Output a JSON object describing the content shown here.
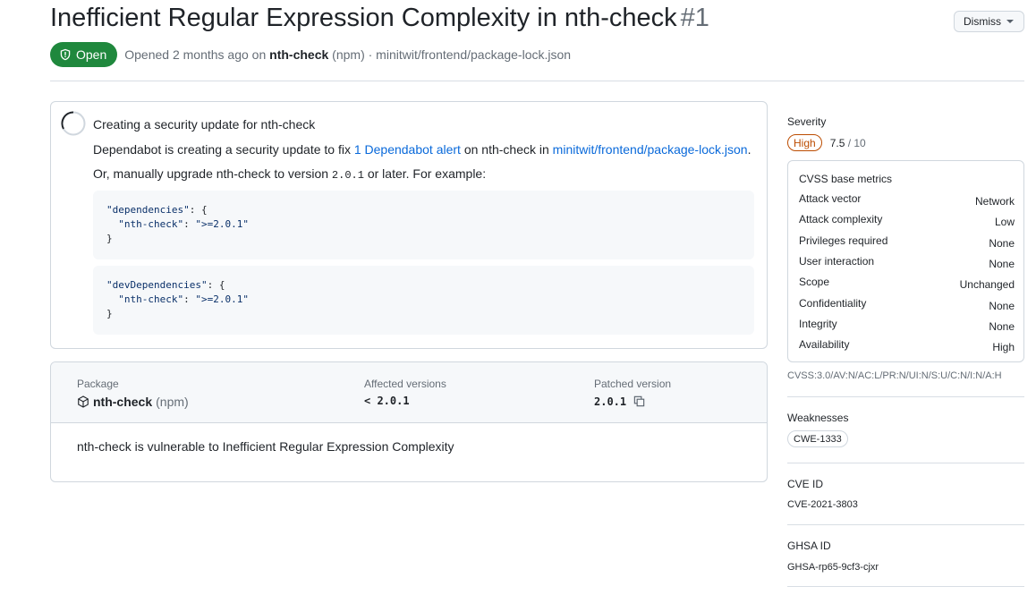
{
  "header": {
    "title": "Inefficient Regular Expression Complexity in nth-check",
    "number": "#1",
    "dismiss_label": "Dismiss"
  },
  "status": {
    "badge": "Open",
    "opened_prefix": "Opened 2 months ago on",
    "package": "nth-check",
    "ecosystem_path": "(npm) · minitwit/frontend/package-lock.json"
  },
  "update": {
    "title": "Creating a security update for nth-check",
    "line1_prefix": "Dependabot is creating a security update to fix",
    "alert_link": "1 Dependabot alert",
    "line1_mid": "on nth-check in",
    "file_link": "minitwit/frontend/package-lock.json",
    "line1_suffix": ".",
    "line2_prefix": "Or, manually upgrade nth-check to version",
    "line2_version": "2.0.1",
    "line2_suffix": "or later. For example:",
    "code_blocks": [
      {
        "key": "\"dependencies\"",
        "pkg": "\"nth-check\"",
        "ver": "\">=2.0.1\""
      },
      {
        "key": "\"devDependencies\"",
        "pkg": "\"nth-check\"",
        "ver": "\">=2.0.1\""
      }
    ]
  },
  "package_info": {
    "package_label": "Package",
    "package_name": "nth-check",
    "package_ecosystem": "(npm)",
    "affected_label": "Affected versions",
    "affected_value": "< 2.0.1",
    "patched_label": "Patched version",
    "patched_value": "2.0.1",
    "description": "nth-check is vulnerable to Inefficient Regular Expression Complexity"
  },
  "sidebar": {
    "severity_label": "Severity",
    "severity_level": "High",
    "score": "7.5",
    "score_of": "/ 10",
    "cvss_title": "CVSS base metrics",
    "metrics": [
      {
        "label": "Attack vector",
        "value": "Network"
      },
      {
        "label": "Attack complexity",
        "value": "Low"
      },
      {
        "label": "Privileges required",
        "value": "None"
      },
      {
        "label": "User interaction",
        "value": "None"
      },
      {
        "label": "Scope",
        "value": "Unchanged"
      },
      {
        "label": "Confidentiality",
        "value": "None"
      },
      {
        "label": "Integrity",
        "value": "None"
      },
      {
        "label": "Availability",
        "value": "High"
      }
    ],
    "vector": "CVSS:3.0/AV:N/AC:L/PR:N/UI:N/S:U/C:N/I:N/A:H",
    "weaknesses_label": "Weaknesses",
    "cwe": "CWE-1333",
    "cve_label": "CVE ID",
    "cve": "CVE-2021-3803",
    "ghsa_label": "GHSA ID",
    "ghsa": "GHSA-rp65-9cf3-cjxr"
  },
  "colors": {
    "open_green": "#1f883d",
    "link_blue": "#0969da",
    "high_orange": "#bc4c00"
  }
}
